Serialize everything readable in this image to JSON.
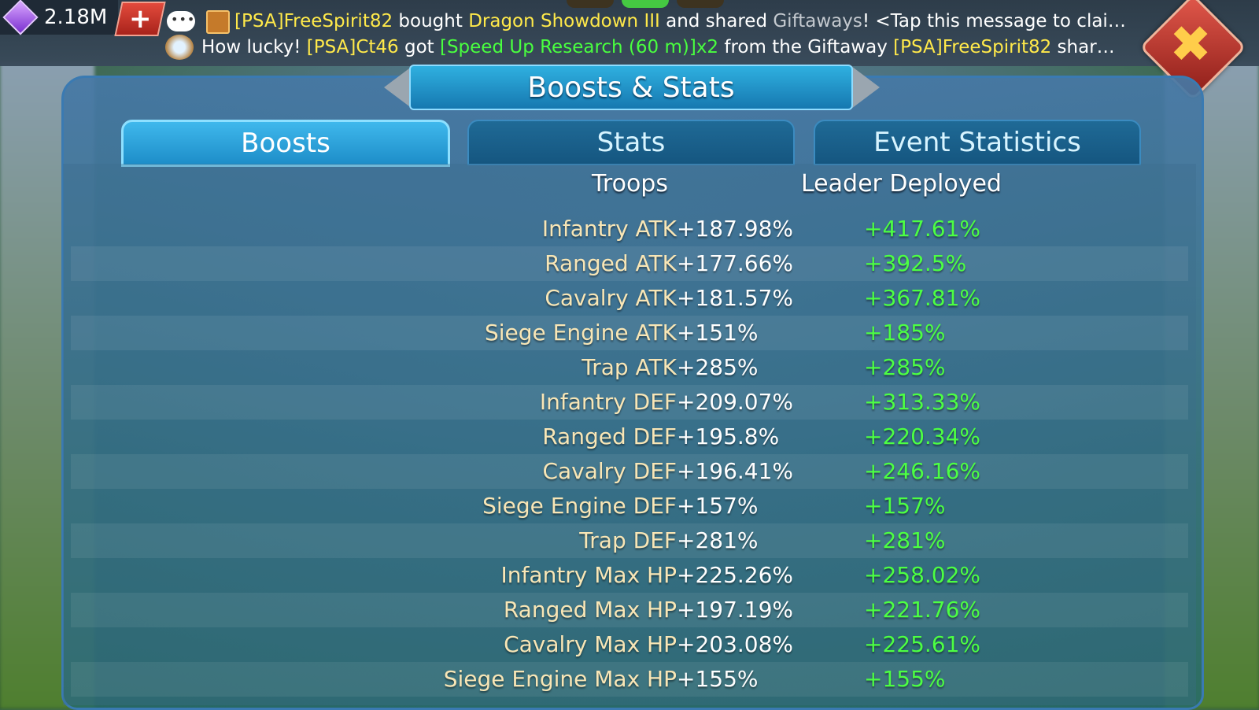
{
  "currency": {
    "gems": "2.18M",
    "add_label": "+"
  },
  "chat": {
    "line1": {
      "player": "[PSA]FreeSpirit82",
      "t1": " bought ",
      "item": "Dragon Showdown III",
      "t2": " and shared ",
      "gift": "Giftaways",
      "t3": "!  <Tap this message to clai…"
    },
    "line2": {
      "t0": "How lucky!  ",
      "player": "[PSA]Ct46",
      "t1": " got ",
      "item": "[Speed Up Research (60 m)]x2",
      "t2": " from the Giftaway ",
      "player2": "[PSA]FreeSpirit82",
      "t3": " shar…"
    }
  },
  "close_label": "✖",
  "title": "Boosts & Stats",
  "tabs": [
    {
      "label": "Boosts",
      "active": true
    },
    {
      "label": "Stats",
      "active": false
    },
    {
      "label": "Event Statistics",
      "active": false
    }
  ],
  "columns": {
    "troops": "Troops",
    "leader": "Leader Deployed"
  },
  "rows": [
    {
      "name": "Infantry ATK",
      "troops": "+187.98%",
      "leader": "+417.61%"
    },
    {
      "name": "Ranged ATK",
      "troops": "+177.66%",
      "leader": "+392.5%"
    },
    {
      "name": "Cavalry ATK",
      "troops": "+181.57%",
      "leader": "+367.81%"
    },
    {
      "name": "Siege Engine ATK",
      "troops": "+151%",
      "leader": "+185%"
    },
    {
      "name": "Trap ATK",
      "troops": "+285%",
      "leader": "+285%"
    },
    {
      "name": "Infantry DEF",
      "troops": "+209.07%",
      "leader": "+313.33%"
    },
    {
      "name": "Ranged DEF",
      "troops": "+195.8%",
      "leader": "+220.34%"
    },
    {
      "name": "Cavalry DEF",
      "troops": "+196.41%",
      "leader": "+246.16%"
    },
    {
      "name": "Siege Engine DEF",
      "troops": "+157%",
      "leader": "+157%"
    },
    {
      "name": "Trap DEF",
      "troops": "+281%",
      "leader": "+281%"
    },
    {
      "name": "Infantry Max HP",
      "troops": "+225.26%",
      "leader": "+258.02%"
    },
    {
      "name": "Ranged Max HP",
      "troops": "+197.19%",
      "leader": "+221.76%"
    },
    {
      "name": "Cavalry Max HP",
      "troops": "+203.08%",
      "leader": "+225.61%"
    },
    {
      "name": "Siege Engine Max HP",
      "troops": "+155%",
      "leader": "+155%"
    }
  ]
}
